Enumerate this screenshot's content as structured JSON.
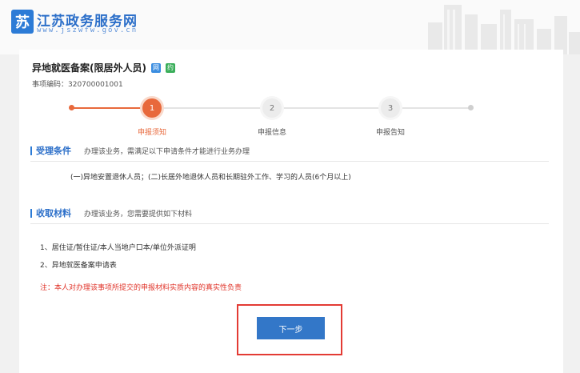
{
  "header": {
    "logo_glyph": "苏",
    "site_title": "江苏政务服务网",
    "site_url": "www.jszwfw.gov.cn"
  },
  "page": {
    "title": "异地就医备案(限居外人员)",
    "badge_1": "网",
    "badge_2": "约",
    "item_code": "事项编码：320700001001"
  },
  "steps": [
    {
      "number": "1",
      "label": "申报须知",
      "active": true
    },
    {
      "number": "2",
      "label": "申报信息",
      "active": false
    },
    {
      "number": "3",
      "label": "申报告知",
      "active": false
    }
  ],
  "acceptance": {
    "title": "受理条件",
    "desc": "办理该业务，需满足以下申请条件才能进行业务办理",
    "content": "(一)异地安置退休人员；(二)长居外地退休人员和长期驻外工作、学习的人员(6个月以上)"
  },
  "materials": {
    "title": "收取材料",
    "desc": "办理该业务，您需要提供如下材料",
    "items": [
      "1、居住证/暂住证/本人当地户口本/单位外派证明",
      "2、异地就医备案申请表"
    ],
    "note": "注：本人对办理该事项所提交的申报材料实质内容的真实性负责"
  },
  "actions": {
    "next_label": "下一步"
  },
  "colors": {
    "accent": "#e8693c",
    "brand": "#2c7bd6",
    "button": "#3377c8",
    "highlight": "#e33b34",
    "note": "#e0342a"
  }
}
